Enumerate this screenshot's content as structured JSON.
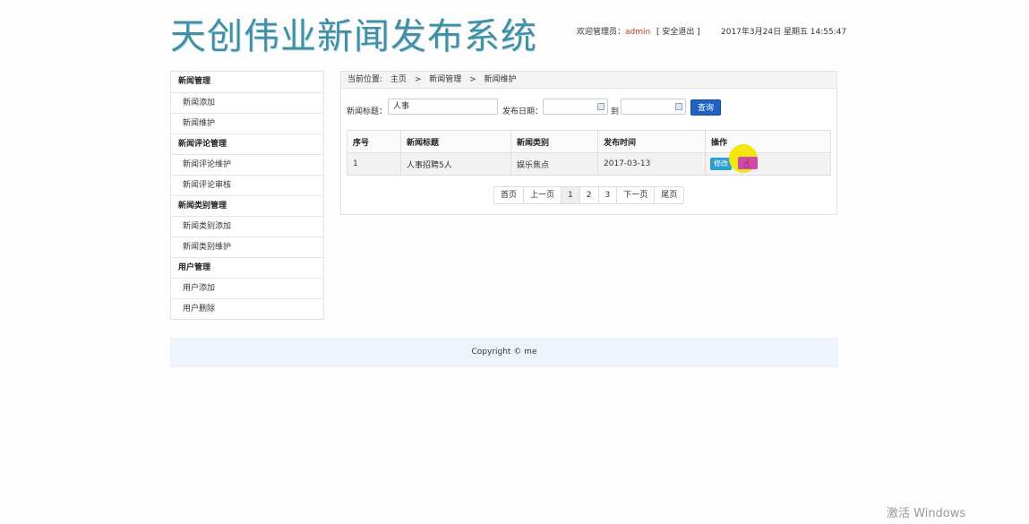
{
  "header": {
    "logo_text": "天创伟业新闻发布系统",
    "welcome_prefix": "欢迎管理员：",
    "admin_name": "admin",
    "logout": "[ 安全退出 ]",
    "datetime": "2017年3月24日 星期五 14:55:47"
  },
  "sidebar": {
    "groups": [
      {
        "title": "新闻管理",
        "items": [
          "新闻添加",
          "新闻维护"
        ]
      },
      {
        "title": "新闻评论管理",
        "items": [
          "新闻评论维护",
          "新闻评论审核"
        ]
      },
      {
        "title": "新闻类别管理",
        "items": [
          "新闻类别添加",
          "新闻类别维护"
        ]
      },
      {
        "title": "用户管理",
        "items": [
          "用户添加",
          "用户删除"
        ]
      }
    ]
  },
  "breadcrumb": {
    "prefix": "当前位置:",
    "items": [
      "主页",
      ">",
      "新闻管理",
      ">",
      "新闻维护"
    ]
  },
  "search": {
    "title_label": "新闻标题：",
    "title_value": "人事",
    "date_label": "发布日期：",
    "to_label": "到",
    "query_button": "查询"
  },
  "table": {
    "headers": [
      "序号",
      "新闻标题",
      "新闻类别",
      "发布时间",
      "操作"
    ],
    "rows": [
      {
        "id": "1",
        "title": "人事招聘5人",
        "category": "娱乐焦点",
        "date": "2017-03-13"
      }
    ],
    "edit_button": "修改"
  },
  "pager": {
    "first": "首页",
    "prev": "上一页",
    "pages": [
      "1",
      "2",
      "3"
    ],
    "next": "下一页",
    "last": "尾页"
  },
  "footer": {
    "copyright": "Copyright © me"
  },
  "watermark": "激活 Windows",
  "colors": {
    "accent": "#1e63c4",
    "edit": "#2a9fd0",
    "delete": "#d04aa8",
    "highlight": "#f4e70d"
  }
}
